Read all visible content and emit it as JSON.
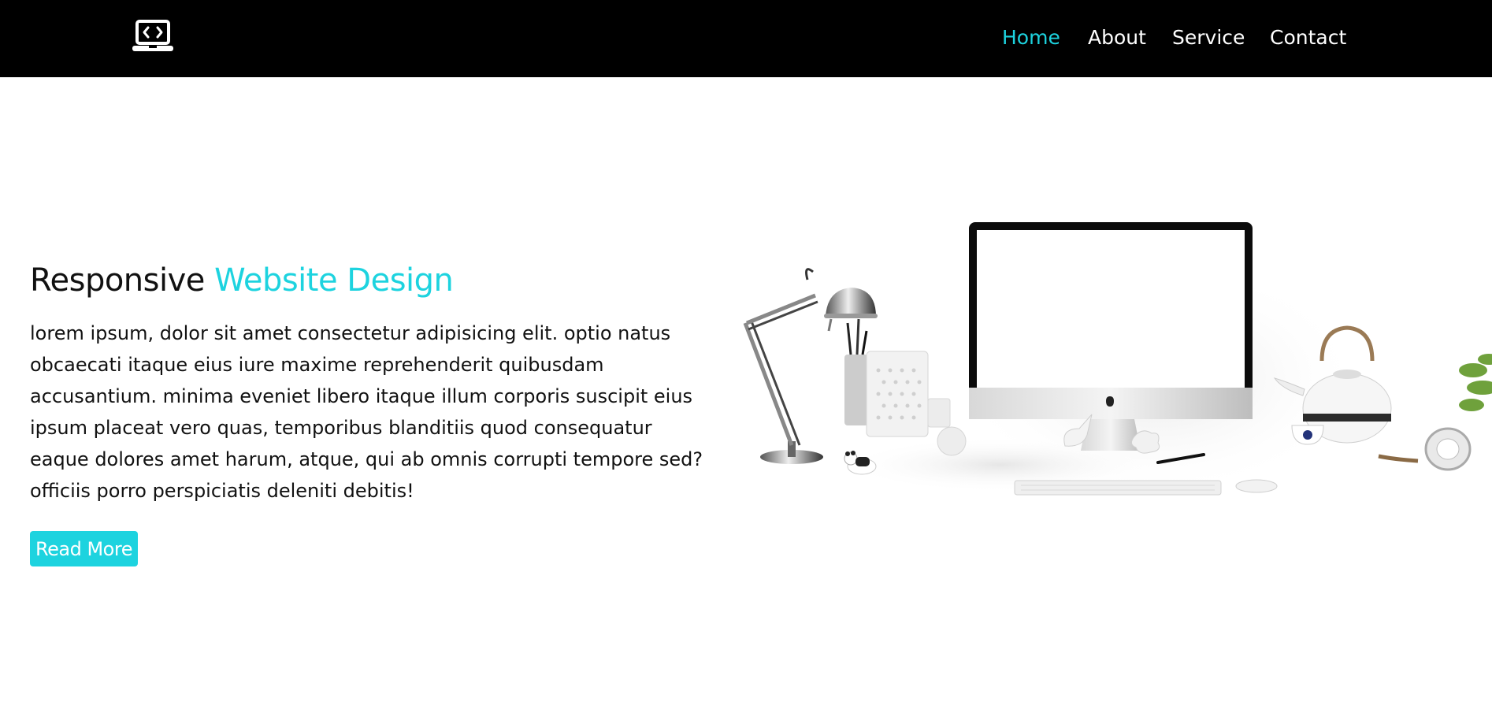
{
  "header": {
    "logo_icon": "laptop-code-icon",
    "nav": [
      {
        "label": "Home",
        "active": true
      },
      {
        "label": "About",
        "active": false
      },
      {
        "label": "Service",
        "active": false
      },
      {
        "label": "Contact",
        "active": false
      }
    ]
  },
  "hero": {
    "title_part1": "Responsive",
    "title_part2": "Website Design",
    "body": "lorem ipsum, dolor sit amet consectetur adipisicing elit. optio natus obcaecati itaque eius iure maxime reprehenderit quibusdam accusantium. minima eveniet libero itaque illum corporis suscipit eius ipsum placeat vero quas, temporibus blanditiis quod consequatur eaque dolores amet harum, atque, qui ab omnis corrupti tempore sed? officiis porro perspiciatis deleniti debitis!",
    "button_label": "Read More",
    "image": "desk-with-computer-illustration"
  },
  "colors": {
    "accent": "#1dd3df",
    "header_bg": "#000000",
    "page_bg": "#ffffff"
  }
}
